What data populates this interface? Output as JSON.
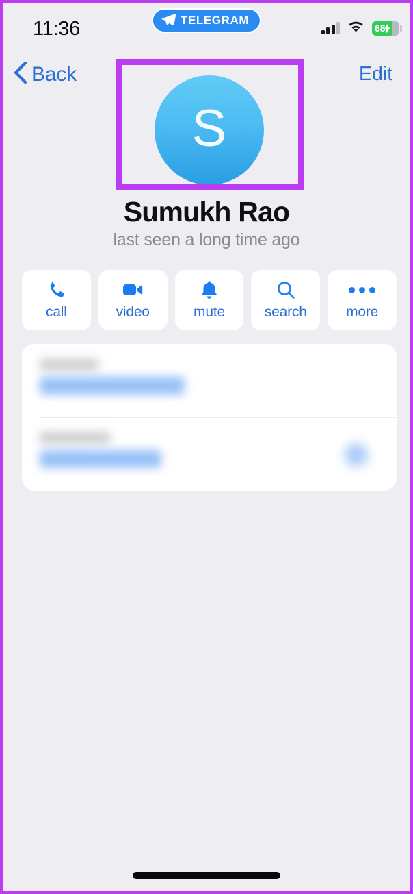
{
  "status_bar": {
    "time": "11:36",
    "telegram_badge": {
      "label": "TELEGRAM",
      "icon": "paper-plane-icon",
      "color": "#2a8bf2"
    },
    "signal_icon": "cellular-signal-icon",
    "wifi_icon": "wifi-icon",
    "battery": {
      "percent": "68",
      "charging": true,
      "color": "#32cc58"
    }
  },
  "nav_bar": {
    "back_label": "Back",
    "back_icon": "chevron-left-icon",
    "edit_label": "Edit",
    "link_color": "#2f6fd0"
  },
  "profile": {
    "avatar_initial": "S",
    "avatar_color_top": "#62cbf6",
    "avatar_color_bottom": "#2a9de4",
    "name": "Sumukh Rao",
    "status": "last seen a long time ago",
    "highlight_color": "#bb3df2"
  },
  "actions": [
    {
      "label": "call",
      "icon": "phone-icon"
    },
    {
      "label": "video",
      "icon": "video-camera-icon"
    },
    {
      "label": "mute",
      "icon": "bell-icon"
    },
    {
      "label": "search",
      "icon": "magnifier-icon"
    },
    {
      "label": "more",
      "icon": "ellipsis-icon"
    }
  ],
  "info_card": {
    "redacted": true,
    "rows": [
      {
        "label": "",
        "value": "",
        "redacted": true
      },
      {
        "label": "",
        "value": "",
        "redacted": true,
        "has_chip": true
      }
    ]
  },
  "home_indicator": {
    "visible": true
  }
}
